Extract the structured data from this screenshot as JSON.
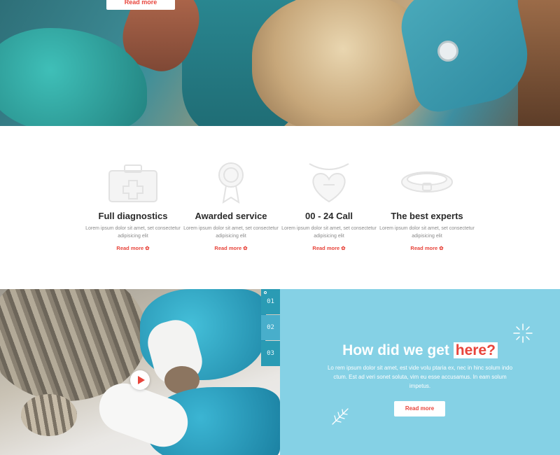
{
  "hero": {
    "read_more_label": "Read more"
  },
  "features": [
    {
      "title": "Full diagnostics",
      "description": "Lorem ipsum dolor sit amet, set consectetur adipisicing elit",
      "link": "Read more",
      "icon": "first-aid-kit-icon"
    },
    {
      "title": "Awarded service",
      "description": "Lorem ipsum dolor sit amet, set consectetur adipisicing elit",
      "link": "Read more",
      "icon": "award-ribbon-icon"
    },
    {
      "title": "00 - 24 Call",
      "description": "Lorem ipsum dolor sit amet, set consectetur adipisicing elit",
      "link": "Read more",
      "icon": "heart-tag-icon"
    },
    {
      "title": "The best experts",
      "description": "Lorem ipsum dolor sit amet, set consectetur adipisicing elit",
      "link": "Read more",
      "icon": "pet-collar-icon"
    }
  ],
  "slider": {
    "tabs": [
      "01",
      "02",
      "03"
    ],
    "active_tab": "02"
  },
  "story": {
    "title_prefix": "How did we get",
    "title_highlight": "here?",
    "text": "Lo rem ipsum dolor sit amet, est vide volu ptaria ex, nec in hinc solum indo ctum. Est ad veri sonet soluta, vim eu esse accusamus. In eam solum impetus.",
    "button_label": "Read more"
  },
  "colors": {
    "accent": "#e8453c",
    "teal": "#85d1e5",
    "teal_dark": "#2a9bb4"
  }
}
